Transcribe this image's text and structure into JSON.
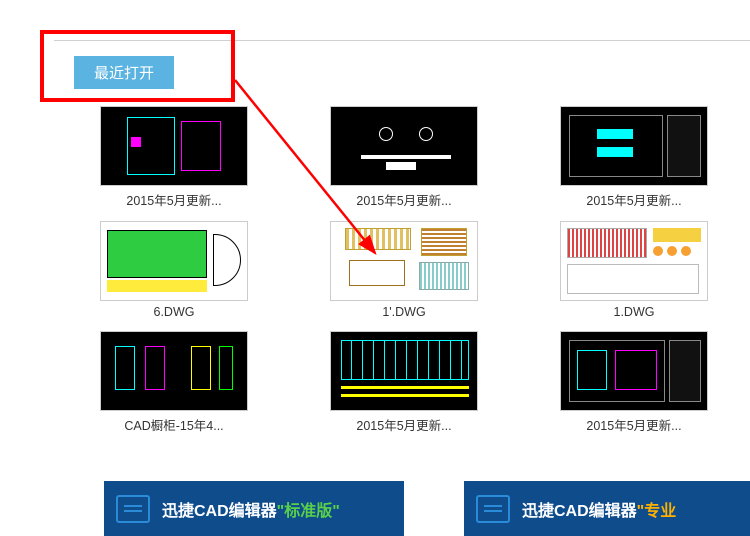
{
  "tab": {
    "label": "最近打开"
  },
  "files": [
    {
      "name": "2015年5月更新...",
      "bg": "black",
      "pattern": "a"
    },
    {
      "name": "2015年5月更新...",
      "bg": "black",
      "pattern": "b"
    },
    {
      "name": "2015年5月更新...",
      "bg": "black",
      "pattern": "c"
    },
    {
      "name": "6.DWG",
      "bg": "white",
      "pattern": "d"
    },
    {
      "name": "1'.DWG",
      "bg": "white",
      "pattern": "e"
    },
    {
      "name": "1.DWG",
      "bg": "white",
      "pattern": "f"
    },
    {
      "name": "CAD橱柜-15年4...",
      "bg": "black",
      "pattern": "g"
    },
    {
      "name": "2015年5月更新...",
      "bg": "black",
      "pattern": "h"
    },
    {
      "name": "2015年5月更新...",
      "bg": "black",
      "pattern": "i"
    }
  ],
  "banners": {
    "standard": {
      "prefix": "迅捷CAD编辑器",
      "suffix": "\"标准版\""
    },
    "pro": {
      "prefix": "迅捷CAD编辑器",
      "suffix": "\"专业"
    }
  }
}
